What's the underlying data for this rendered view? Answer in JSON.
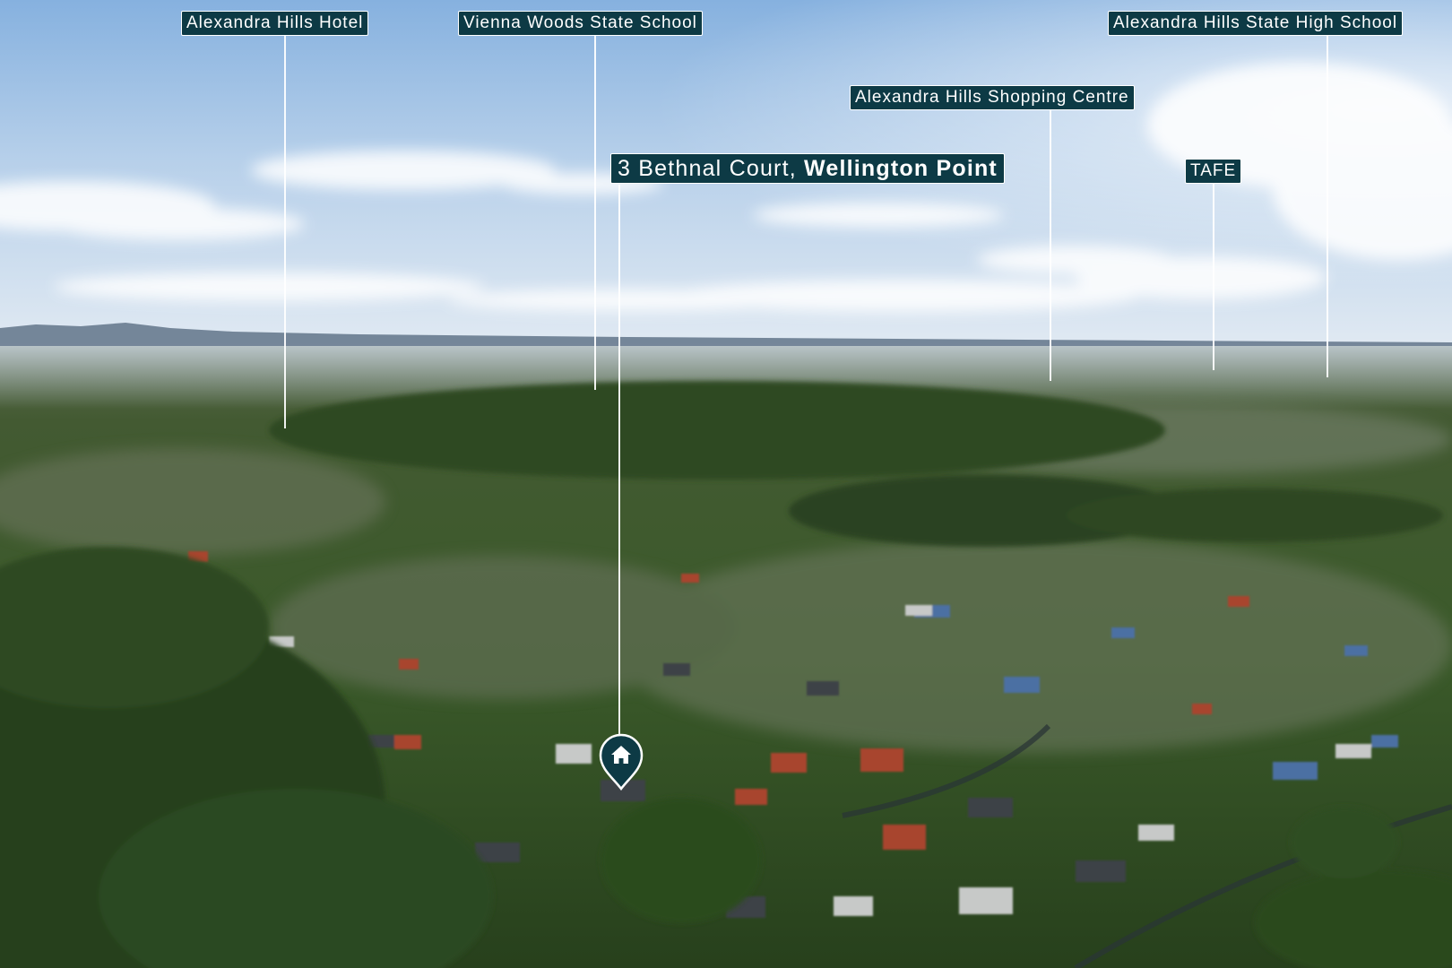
{
  "property": {
    "street": "3 Bethnal Court,",
    "suburb": "Wellington Point",
    "pin_icon": "house-icon"
  },
  "landmarks": [
    "Alexandra Hills Hotel",
    "Vienna Woods State School",
    "Alexandra Hills State High School",
    "Alexandra Hills Shopping Centre",
    "TAFE"
  ],
  "colors": {
    "label_background": "#0d3a45",
    "label_text": "#ffffff",
    "sky": "#8fb6e0",
    "foliage": "#2f4a22"
  }
}
